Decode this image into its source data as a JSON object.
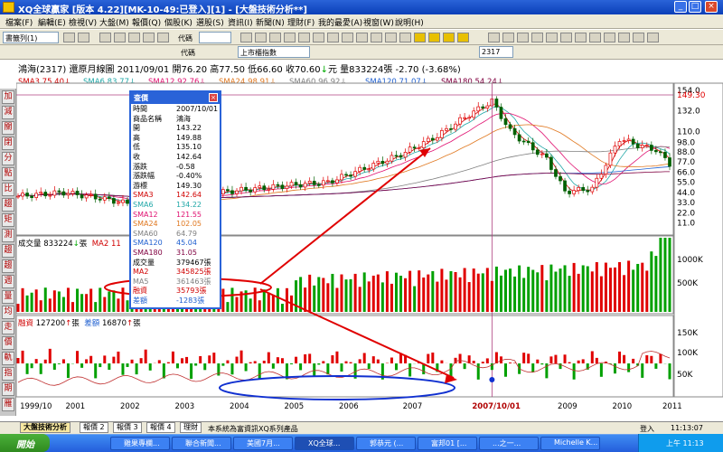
{
  "window": {
    "title": "XQ全球贏家 [版本 4.22][MK-10-49:已登入][1] - [大盤技術分析**]",
    "controls": [
      "_",
      "□",
      "×"
    ]
  },
  "menu": [
    "檔案(F)",
    "編輯(E)",
    "檢視(V)",
    "大盤(M)",
    "報價(Q)",
    "個股(K)",
    "選股(S)",
    "資訊(I)",
    "新聞(N)",
    "理財(F)",
    "我的最愛(A)",
    "視窗(W)",
    "說明(H)"
  ],
  "toolbar": {
    "layout_combo": "書籤列(1)",
    "code_label": "代碼",
    "index_label": "代碼",
    "index_combo": "上市櫃指數",
    "stock_combo": "2317"
  },
  "info": {
    "name": "鴻海(2317)",
    "period": "還原月線圖",
    "date": "2011/09/01",
    "open_label": "開",
    "open": "76.20",
    "high_label": "高",
    "high": "77.50",
    "low_label": "低",
    "low": "66.60",
    "close_label": "收",
    "close": "70.60",
    "close_unit": "元",
    "vol_label": "量",
    "volume": "833224",
    "vol_unit": "張",
    "change": "-2.70 (-3.68%)"
  },
  "ma": [
    {
      "label": "SMA3",
      "value": "75.40",
      "color": "#d00000"
    },
    {
      "label": "SMA6",
      "value": "83.77",
      "color": "#22a8a8"
    },
    {
      "label": "SMA12",
      "value": "92.76",
      "color": "#e01070"
    },
    {
      "label": "SMA24",
      "value": "98.91",
      "color": "#e07820"
    },
    {
      "label": "SMA60",
      "value": "96.92",
      "color": "#808080"
    },
    {
      "label": "SMA120",
      "value": "71.07",
      "color": "#2060d0"
    },
    {
      "label": "SMA180",
      "value": "54.24",
      "color": "#800040"
    }
  ],
  "price_axis": [
    "154.0",
    "149.30",
    "132.0",
    "110.0",
    "98.0",
    "88.0",
    "77.0",
    "66.0",
    "55.0",
    "44.0",
    "33.0",
    "22.0",
    "11.0"
  ],
  "vol_header": {
    "label": "成交量",
    "value": "833224",
    "unit": "張",
    "ma_label": "MA2",
    "ma_value": "11"
  },
  "vol_axis": [
    "1000K",
    "500K"
  ],
  "margin_header": {
    "label": "融資",
    "value": "127200",
    "unit": "張",
    "label2": "差額",
    "value2": "16870",
    "unit2": "張"
  },
  "margin_axis": [
    "150K",
    "100K",
    "50K"
  ],
  "x_axis": [
    "1999/10",
    "2001",
    "2002",
    "2003",
    "2004",
    "2005",
    "2006",
    "2007",
    "2007/10/01",
    "2009",
    "2010",
    "2011"
  ],
  "popup": {
    "title": "查價",
    "rows": [
      {
        "k": "時間",
        "v": "2007/10/01",
        "c": "#000"
      },
      {
        "k": "商品名稱",
        "v": "鴻海",
        "c": "#000"
      },
      {
        "k": "開",
        "v": "143.22",
        "c": "#000"
      },
      {
        "k": "高",
        "v": "149.88",
        "c": "#000"
      },
      {
        "k": "低",
        "v": "135.10",
        "c": "#000"
      },
      {
        "k": "收",
        "v": "142.64",
        "c": "#000"
      },
      {
        "k": "漲跌",
        "v": "-0.58",
        "c": "#000"
      },
      {
        "k": "漲跌幅",
        "v": "-0.40%",
        "c": "#000"
      },
      {
        "k": "游標",
        "v": "149.30",
        "c": "#000"
      },
      {
        "k": "SMA3",
        "v": "142.64",
        "c": "#d00000"
      },
      {
        "k": "SMA6",
        "v": "134.22",
        "c": "#22a8a8"
      },
      {
        "k": "SMA12",
        "v": "121.55",
        "c": "#e01070"
      },
      {
        "k": "SMA24",
        "v": "102.05",
        "c": "#e07820"
      },
      {
        "k": "SMA60",
        "v": "64.79",
        "c": "#808080"
      },
      {
        "k": "SMA120",
        "v": "45.04",
        "c": "#2060d0"
      },
      {
        "k": "SMA180",
        "v": "31.05",
        "c": "#800040"
      },
      {
        "k": "成交量",
        "v": "379467張",
        "c": "#000"
      },
      {
        "k": "MA2",
        "v": "345825張",
        "c": "#d00000"
      },
      {
        "k": "MA5",
        "v": "361463張",
        "c": "#808080"
      },
      {
        "k": "融資",
        "v": "35793張",
        "c": "#d00000"
      },
      {
        "k": "差額",
        "v": "-1283張",
        "c": "#2060d0"
      }
    ]
  },
  "left_buttons": [
    "加",
    "減",
    "關",
    "閉",
    "分",
    "點",
    "比",
    "趨",
    "矩",
    "測",
    "趨",
    "趨",
    "週",
    "量",
    "均",
    "走",
    "價",
    "軌",
    "指",
    "期",
    "雁"
  ],
  "tabs": [
    "大盤技術分析",
    "報價 2",
    "報價 3",
    "報價 4",
    "理財",
    "本系統為富資訊XQ系列產品"
  ],
  "status": {
    "logged": "登入",
    "time": "11:13:07"
  },
  "taskbar": {
    "start": "開始",
    "items": [
      "雞果專欄...",
      "聯合新聞...",
      "美國7月...",
      "XQ全球...",
      "郭恭元 (...",
      "富邦01 [...",
      "...之一...",
      "Michelle K..."
    ],
    "clock": "上午 11:13"
  },
  "chart_data": [
    {
      "type": "candlestick",
      "title": "還原月線圖",
      "series": [
        {
          "name": "收盤",
          "x": [
            "1999/10",
            "2001",
            "2002",
            "2003",
            "2004",
            "2005",
            "2006",
            "2007",
            "2007/10/01",
            "2009",
            "2010",
            "2011"
          ],
          "y": [
            40,
            44,
            36,
            38,
            52,
            60,
            82,
            112,
            142.64,
            40,
            102,
            75
          ]
        }
      ],
      "ylim": [
        0,
        154
      ],
      "highlight": {
        "date": "2007/10/01",
        "high": "149.88",
        "cursor": "149.30"
      }
    },
    {
      "type": "bar",
      "title": "成交量",
      "ylim": [
        0,
        1100000
      ],
      "series": [
        {
          "name": "成交量",
          "last": 833224
        }
      ]
    },
    {
      "type": "bar",
      "title": "融資",
      "ylim": [
        0,
        160000
      ],
      "series": [
        {
          "name": "融資",
          "last": 127200
        },
        {
          "name": "差額",
          "last": 16870
        }
      ]
    }
  ]
}
